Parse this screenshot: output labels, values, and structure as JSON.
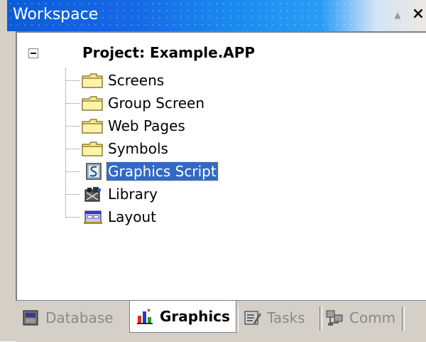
{
  "window": {
    "title": "Workspace",
    "restore_glyph": "▲",
    "close_glyph": "×"
  },
  "tree": {
    "root": {
      "label": "Project: Example.APP",
      "expanded": true,
      "toggle_icon": "minus-box-icon"
    },
    "items": [
      {
        "label": "Screens",
        "icon": "folder-icon",
        "selected": false
      },
      {
        "label": "Group Screen",
        "icon": "folder-icon",
        "selected": false
      },
      {
        "label": "Web Pages",
        "icon": "folder-icon",
        "selected": false
      },
      {
        "label": "Symbols",
        "icon": "folder-icon",
        "selected": false
      },
      {
        "label": "Graphics Script",
        "icon": "script-icon",
        "selected": true
      },
      {
        "label": "Library",
        "icon": "library-icon",
        "selected": false
      },
      {
        "label": "Layout",
        "icon": "layout-icon",
        "selected": false
      }
    ]
  },
  "tabs": [
    {
      "label": "Database",
      "icon": "database-icon",
      "active": false
    },
    {
      "label": "Graphics",
      "icon": "graphics-icon",
      "active": true
    },
    {
      "label": "Tasks",
      "icon": "tasks-icon",
      "active": false
    },
    {
      "label": "Comm",
      "icon": "comm-icon",
      "active": false
    }
  ],
  "colors": {
    "selection": "#316ac5",
    "titlebar": "#0a5cd8",
    "folder": "#ffe98a"
  }
}
